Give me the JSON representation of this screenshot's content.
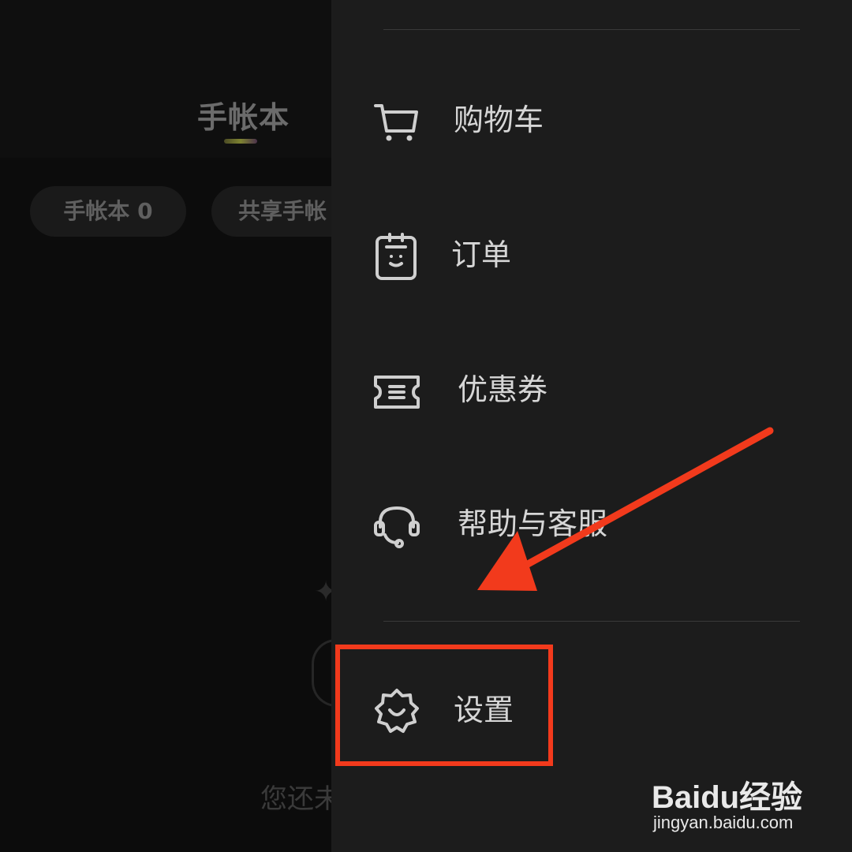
{
  "background": {
    "title": "手帐本",
    "chips": [
      "手帐本 0",
      "共享手帐"
    ],
    "empty_text": "您还未"
  },
  "drawer": {
    "menu": [
      {
        "label": "购物车",
        "icon": "shopping-cart-icon"
      },
      {
        "label": "订单",
        "icon": "order-clipboard-icon"
      },
      {
        "label": "优惠券",
        "icon": "coupon-ticket-icon"
      },
      {
        "label": "帮助与客服",
        "icon": "headset-support-icon"
      }
    ],
    "settings": {
      "label": "设置",
      "icon": "settings-gear-icon"
    }
  },
  "annotation": {
    "color": "#f23a1c",
    "target": "设置"
  },
  "watermark": {
    "logo_text": "Bai",
    "logo_du": "du",
    "logo_suffix": "经验",
    "url": "jingyan.baidu.com"
  },
  "colors": {
    "drawer_bg": "#1c1c1c",
    "menu_text": "#d6d6d6",
    "accent_red": "#f23a1c"
  }
}
